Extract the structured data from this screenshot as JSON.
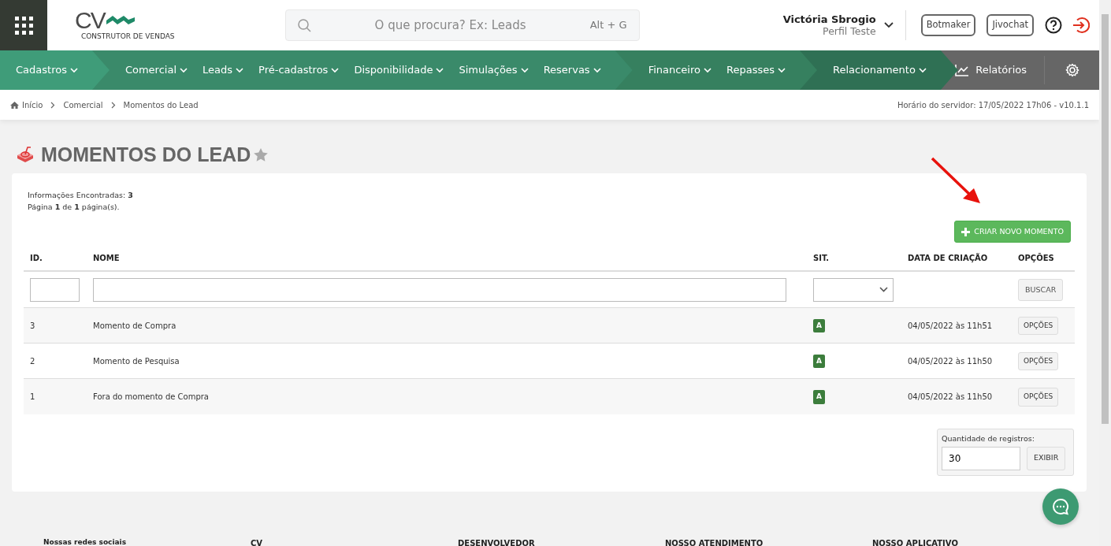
{
  "header": {
    "logo_text": "CV",
    "logo_tagline": "CONSTRUTOR DE VENDAS",
    "search": {
      "placeholder": "O que procura? Ex: Leads",
      "shortcut": "Alt + G"
    },
    "user": {
      "name": "Victória Sbrogio",
      "profile": "Perfil Teste"
    },
    "buttons": [
      "Botmaker",
      "Jivochat"
    ]
  },
  "nav": {
    "segments": [
      {
        "items": [
          "Cadastros"
        ]
      },
      {
        "items": [
          "Comercial",
          "Leads",
          "Pré-cadastros",
          "Disponibilidade",
          "Simulações",
          "Reservas"
        ]
      },
      {
        "items": [
          "Financeiro",
          "Repasses"
        ]
      },
      {
        "items": [
          "Relacionamento"
        ]
      }
    ],
    "reports": "Relatórios"
  },
  "breadcrumb": [
    "Início",
    "Comercial",
    "Momentos do Lead"
  ],
  "server_time": "Horário do servidor: 17/05/2022 17h06 - v10.1.1",
  "page_title": "MOMENTOS DO LEAD",
  "summary": [
    "Informações Encontradas: **3**",
    "Página **1** de **1** página(s)."
  ],
  "create_button": "CRIAR NOVO MOMENTO",
  "table": {
    "columns": [
      "ID.",
      "NOME",
      "SIT.",
      "DATA DE CRIAÇÃO",
      "OPÇÕES"
    ],
    "search_button": "BUSCAR",
    "rows": [
      {
        "id": "3",
        "name": "Momento de Compra",
        "status": "A",
        "date": "04/05/2022 às 11h51",
        "options": "OPÇÕES"
      },
      {
        "id": "2",
        "name": "Momento de Pesquisa",
        "status": "A",
        "date": "04/05/2022 às 11h50",
        "options": "OPÇÕES"
      },
      {
        "id": "1",
        "name": "Fora do momento de Compra",
        "status": "A",
        "date": "04/05/2022 às 11h50",
        "options": "OPÇÕES"
      }
    ]
  },
  "records": {
    "label": "Quantidade de registros:",
    "value": "30",
    "button": "EXIBIR"
  },
  "footer": [
    "Nossas redes sociais",
    "CV",
    "DESENVOLVEDOR",
    "NOSSO ATENDIMENTO",
    "NOSSO APLICATIVO"
  ]
}
